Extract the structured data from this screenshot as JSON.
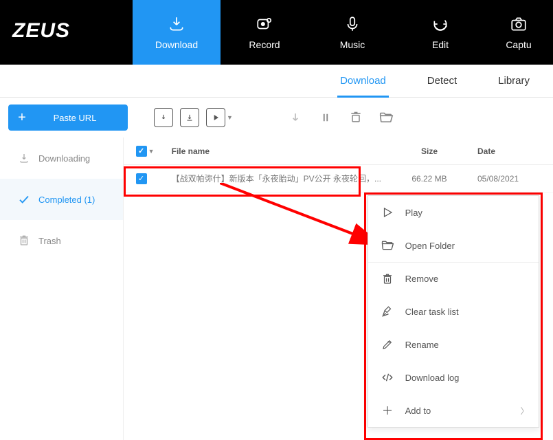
{
  "logo": "ZEUS",
  "topnav": {
    "download": "Download",
    "record": "Record",
    "music": "Music",
    "edit": "Edit",
    "capture": "Captu"
  },
  "subtabs": {
    "download": "Download",
    "detect": "Detect",
    "library": "Library"
  },
  "toolbar": {
    "paste_label": "Paste URL"
  },
  "sidebar": {
    "downloading": "Downloading",
    "completed": "Completed (1)",
    "trash": "Trash"
  },
  "columns": {
    "filename": "File name",
    "size": "Size",
    "date": "Date"
  },
  "files": [
    {
      "name": "【战双帕弥什】新版本「永夜胎动」PV公开  永夜轮回，...",
      "size": "66.22 MB",
      "date": "05/08/2021"
    }
  ],
  "ctx": {
    "play": "Play",
    "open_folder": "Open Folder",
    "remove": "Remove",
    "clear": "Clear task list",
    "rename": "Rename",
    "log": "Download log",
    "addto": "Add to"
  }
}
